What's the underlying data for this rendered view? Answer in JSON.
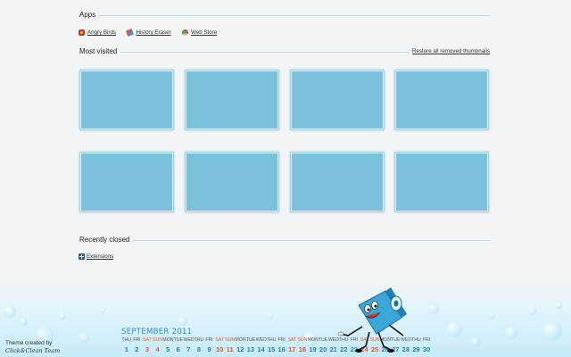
{
  "apps": {
    "title": "Apps",
    "items": [
      {
        "label": "Angry Birds",
        "icon": "angry-birds-icon"
      },
      {
        "label": "History Eraser",
        "icon": "eraser-icon"
      },
      {
        "label": "Web Store",
        "icon": "chrome-store-icon"
      }
    ]
  },
  "most_visited": {
    "title": "Most visited",
    "restore_link": "Restore all removed thumbnails",
    "tile_count": 8
  },
  "recently_closed": {
    "title": "Recently closed",
    "items": [
      {
        "label": "Extensions",
        "icon": "extension-icon"
      }
    ]
  },
  "theme": {
    "credit_line1": "Theme created by",
    "credit_line2": "Click&Clean Team"
  },
  "calendar": {
    "month": "SEPTEMBER",
    "year": "2011",
    "days": [
      "THU",
      "FRI",
      "SAT",
      "SUN",
      "MON",
      "TUE",
      "WED",
      "THU",
      "FRI",
      "SAT",
      "SUN",
      "MON",
      "TUE",
      "WED",
      "THU",
      "FRI",
      "SAT",
      "SUN",
      "MON",
      "TUE",
      "WED",
      "THU",
      "FRI",
      "SAT",
      "SUN",
      "MON",
      "TUE",
      "WED",
      "THU",
      "FRI"
    ],
    "dates": [
      "1",
      "2",
      "3",
      "4",
      "5",
      "6",
      "7",
      "8",
      "9",
      "10",
      "11",
      "12",
      "13",
      "14",
      "15",
      "16",
      "17",
      "18",
      "19",
      "20",
      "21",
      "22",
      "23",
      "24",
      "25",
      "26",
      "27",
      "28",
      "29",
      "30"
    ],
    "weekend_color": "#e8552a",
    "weekday_color": "#1e7fb8"
  }
}
